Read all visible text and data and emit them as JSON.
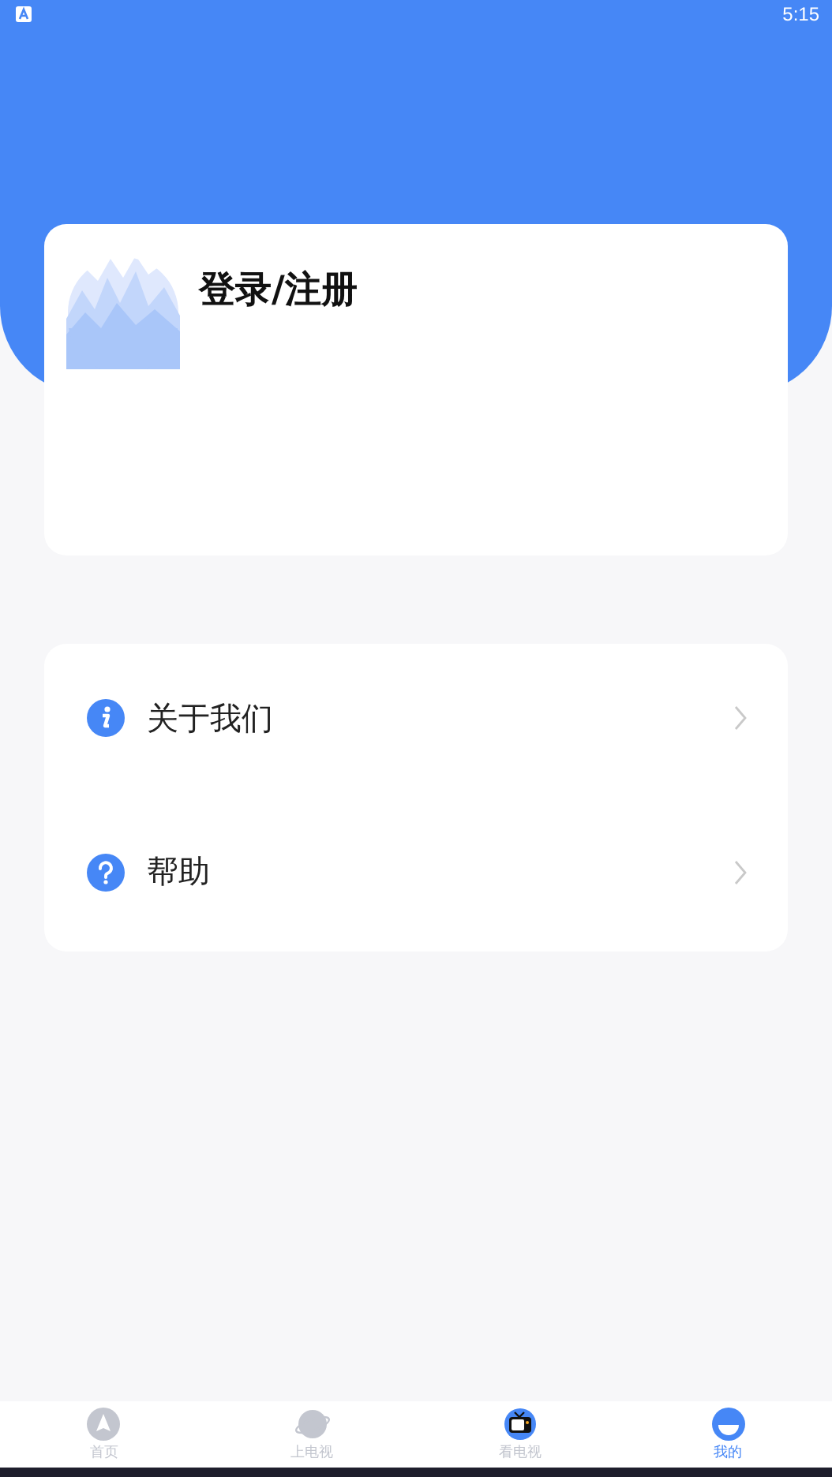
{
  "status_bar": {
    "time": "5:15"
  },
  "profile": {
    "login_label": "登录/注册"
  },
  "menu": [
    {
      "kind": "info",
      "label": "关于我们"
    },
    {
      "kind": "help",
      "label": "帮助"
    }
  ],
  "tab_bar": [
    {
      "kind": "home",
      "label": "首页",
      "selected": false
    },
    {
      "kind": "planet",
      "label": "上电视",
      "selected": false
    },
    {
      "kind": "tv",
      "label": "看电视",
      "selected": false
    },
    {
      "kind": "me",
      "label": "我的",
      "selected": true
    }
  ]
}
